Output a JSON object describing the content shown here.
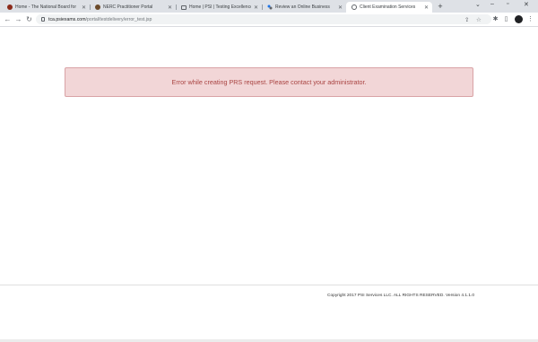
{
  "browser": {
    "tabs": [
      {
        "title": "Home - The National Board for",
        "favicon": "nbme-logo-icon",
        "active": false
      },
      {
        "title": "NERC Practitioner Portal",
        "favicon": "nerc-logo-icon",
        "active": false
      },
      {
        "title": "Home | PSI | Testing Excellence",
        "favicon": "book-icon",
        "active": false
      },
      {
        "title": "Review an Online Business",
        "favicon": "review-icon",
        "active": false
      },
      {
        "title": "Client Examination Services",
        "favicon": "globe-icon",
        "active": true
      }
    ],
    "url_host": "tca.psiexams.com",
    "url_path": "/portal/testdelivery/error_test.jsp"
  },
  "page": {
    "error_message": "Error while creating PRS request. Please contact your administrator.",
    "copyright": "Copyright 2017 PSI Services LLC. ALL RIGHTS RESERVED. Version 4.1.1.0"
  },
  "colors": {
    "error_background": "#f2d6d7",
    "error_border": "#d9a3a6",
    "error_text": "#a94442"
  }
}
